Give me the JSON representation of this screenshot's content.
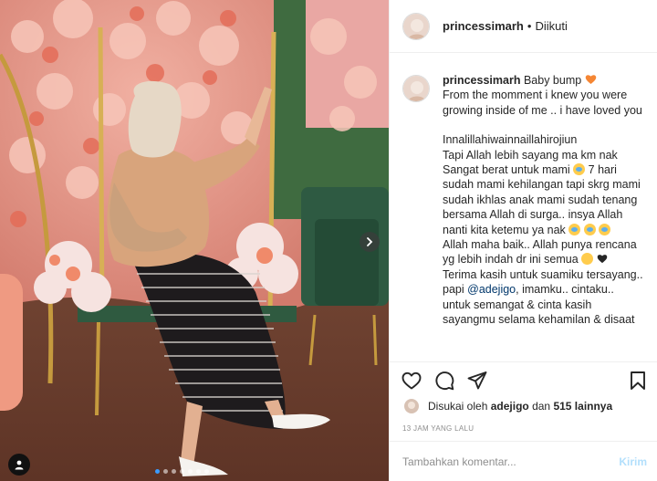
{
  "post": {
    "username": "princessimarh",
    "separator": "•",
    "follow_status": "Diikuti"
  },
  "caption": {
    "username": "princessimarh",
    "line1": "Baby bump",
    "line2": "From the momment i knew you were growing inside of me .. i have loved you",
    "p1": "Innalillahiwainnaillahirojiun",
    "p2a": "Tapi Allah lebih sayang ma km nak Sangat berat untuk mami",
    "p2b": "7 hari sudah mami kehilangan tapi skrg mami sudah ikhlas anak mami sudah tenang bersama Allah di surga.. insya Allah nanti kita ketemu ya nak",
    "p3": "Allah maha baik.. Allah punya rencana yg lebih indah dr ini semua",
    "p4a": "Terima kasih untuk suamiku tersayang.. papi",
    "mention": "@adejigo",
    "p4b": ", imamku.. cintaku.. untuk semangat & cinta kasih sayangmu selama kehamilan & disaat"
  },
  "likes": {
    "prefix": "Disukai oleh",
    "user": "adejigo",
    "mid": "dan",
    "count": "515 lainnya"
  },
  "timestamp": "13 JAM YANG LALU",
  "comment_input": {
    "placeholder": "Tambahkan komentar...",
    "post_label": "Kirim"
  },
  "carousel": {
    "total": 7,
    "active_index": 0
  },
  "icons": {
    "like": "heart-icon",
    "comment": "comment-icon",
    "share": "share-icon",
    "save": "bookmark-icon",
    "next": "chevron-right-icon",
    "tags": "person-tag-icon"
  },
  "colors": {
    "accent_blue": "#3b9cff",
    "link": "#00376b",
    "muted": "#8e8e8e",
    "post_button_disabled": "#b2dffc",
    "heart_emoji": "#f58634"
  }
}
